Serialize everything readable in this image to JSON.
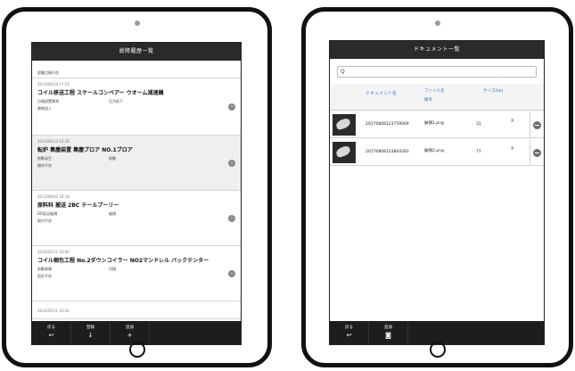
{
  "left": {
    "title": "故障履歴一覧",
    "items": [
      {
        "date": "",
        "title": "",
        "rows": [
          [
            "設備点検不良",
            ""
          ]
        ]
      },
      {
        "date": "2013/06/14 17:53",
        "title": "コイル移送工程 スケールコンベアー ウオーム減速機",
        "rows": [
          [
            "点検設置異常",
            "圧力低下"
          ],
          [
            "異物混入",
            ""
          ]
        ]
      },
      {
        "date": "2013/06/13 10:28",
        "title": "転炉 集塵装置 集塵ブロア NO.1ブロア",
        "rows": [
          [
            "振動発生",
            "振動"
          ],
          [
            "操作不良",
            ""
          ]
        ]
      },
      {
        "date": "2013/06/02 10:18",
        "title": "原料科 搬送 2BC テールプーリー",
        "rows": [
          [
            "DD部品破損",
            "破損"
          ],
          [
            "取付不良",
            ""
          ]
        ]
      },
      {
        "date": "2013/05/11 10:00",
        "title": "コイル梱包工程 No.2ダウンコイラー NO2マンドレル バックテンター",
        "rows": [
          [
            "振動故障",
            "切損"
          ],
          [
            "設計不良",
            ""
          ]
        ]
      },
      {
        "date": "2013/05/11 10:20",
        "title": "",
        "rows": []
      }
    ],
    "footer": [
      {
        "label": "戻る",
        "icon": "↩"
      },
      {
        "label": "登録",
        "icon": "↓"
      },
      {
        "label": "追加",
        "icon": "+"
      }
    ]
  },
  "right": {
    "title": "ドキュメント一覧",
    "search_placeholder": "Q",
    "headers": {
      "name": "ドキュメント名",
      "file": "ファイル名",
      "note": "備考",
      "size": "サイズ(kb)"
    },
    "docs": [
      {
        "name": "20170808123759069",
        "file": "破損1.png",
        "size": "31",
        "x": "X"
      },
      {
        "name": "20170808123804283",
        "file": "破損2.png",
        "size": "77",
        "x": "X"
      }
    ],
    "footer": [
      {
        "label": "戻る",
        "icon": "↩"
      },
      {
        "label": "追加",
        "icon": "◙"
      }
    ]
  }
}
